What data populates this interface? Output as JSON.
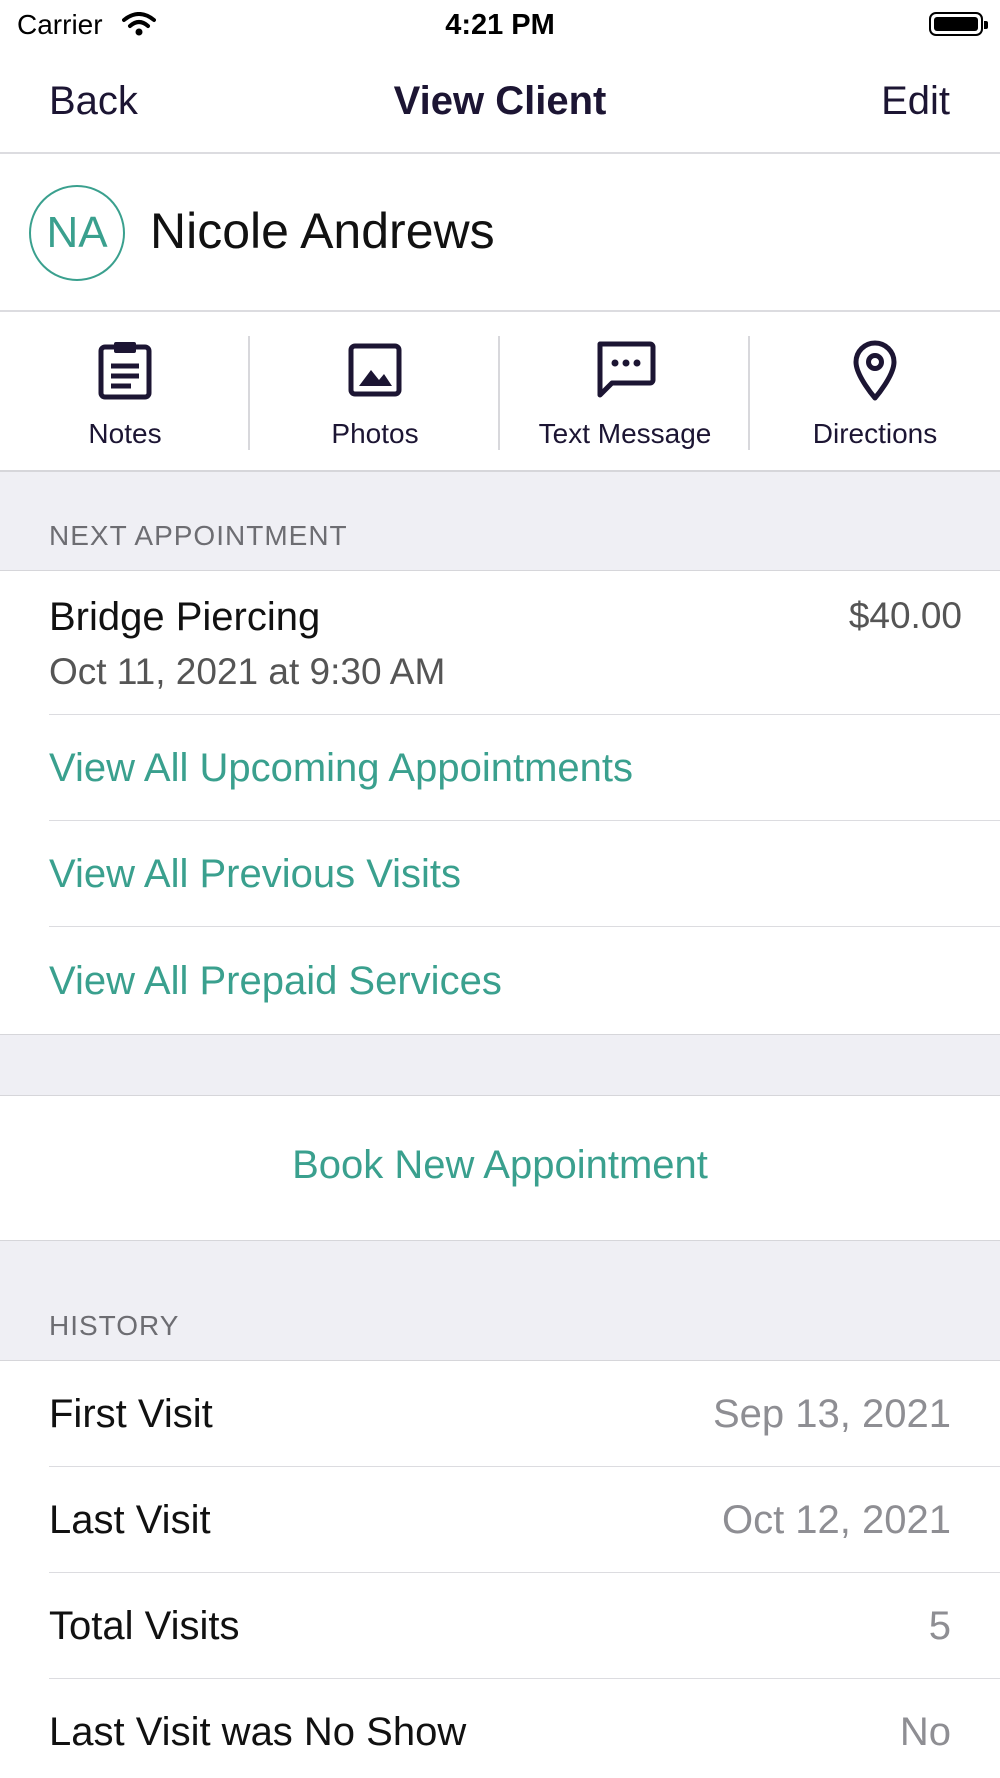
{
  "status_bar": {
    "carrier": "Carrier",
    "time": "4:21 PM"
  },
  "nav": {
    "back": "Back",
    "title": "View Client",
    "edit": "Edit"
  },
  "client": {
    "initials": "NA",
    "name": "Nicole Andrews"
  },
  "actions": [
    {
      "label": "Notes",
      "icon": "clipboard-icon"
    },
    {
      "label": "Photos",
      "icon": "image-icon"
    },
    {
      "label": "Text Message",
      "icon": "chat-bubble-icon"
    },
    {
      "label": "Directions",
      "icon": "map-pin-icon"
    }
  ],
  "next_appointment": {
    "section_title": "NEXT APPOINTMENT",
    "service": "Bridge Piercing",
    "datetime": "Oct 11, 2021 at 9:30 AM",
    "price": "$40.00",
    "links": [
      "View All Upcoming Appointments",
      "View All Previous Visits",
      "View All Prepaid Services"
    ]
  },
  "book_new": "Book New Appointment",
  "history": {
    "section_title": "HISTORY",
    "rows": [
      {
        "label": "First Visit",
        "value": "Sep 13, 2021"
      },
      {
        "label": "Last Visit",
        "value": "Oct 12, 2021"
      },
      {
        "label": "Total Visits",
        "value": "5"
      },
      {
        "label": "Last Visit was No Show",
        "value": "No"
      }
    ]
  },
  "colors": {
    "accent": "#3aa08e",
    "nav_text": "#1c1533",
    "grouped_background": "#efeff4"
  }
}
